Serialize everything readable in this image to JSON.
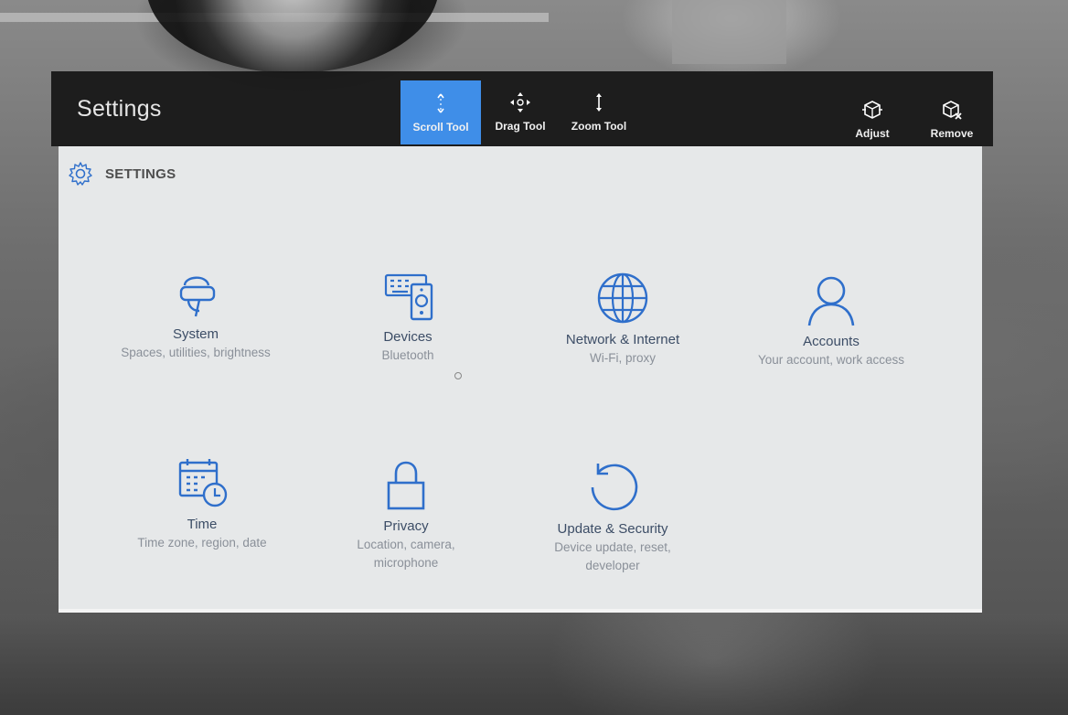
{
  "window": {
    "title": "Settings",
    "tools": [
      {
        "label": "Scroll Tool",
        "icon": "scroll-icon",
        "active": true
      },
      {
        "label": "Drag Tool",
        "icon": "drag-icon",
        "active": false
      },
      {
        "label": "Zoom Tool",
        "icon": "zoom-icon",
        "active": false
      }
    ],
    "actions": [
      {
        "label": "Adjust",
        "icon": "adjust-icon"
      },
      {
        "label": "Remove",
        "icon": "remove-icon"
      }
    ],
    "accent_color": "#3f8ee8"
  },
  "panel": {
    "header": {
      "label": "SETTINGS",
      "icon": "gear-icon"
    },
    "icon_color": "#2f6fcb",
    "tiles": [
      {
        "name": "System",
        "desc": "Spaces, utilities, brightness",
        "icon": "headset-user-icon"
      },
      {
        "name": "Devices",
        "desc": "Bluetooth",
        "icon": "keyboard-speaker-icon"
      },
      {
        "name": "Network & Internet",
        "desc": "Wi-Fi, proxy",
        "icon": "globe-icon"
      },
      {
        "name": "Accounts",
        "desc": "Your account, work access",
        "icon": "person-icon"
      },
      {
        "name": "Time",
        "desc": "Time zone, region, date",
        "icon": "calendar-clock-icon"
      },
      {
        "name": "Privacy",
        "desc": "Location, camera, microphone",
        "icon": "lock-icon"
      },
      {
        "name": "Update & Security",
        "desc": "Device update, reset, developer",
        "icon": "refresh-icon"
      }
    ]
  }
}
